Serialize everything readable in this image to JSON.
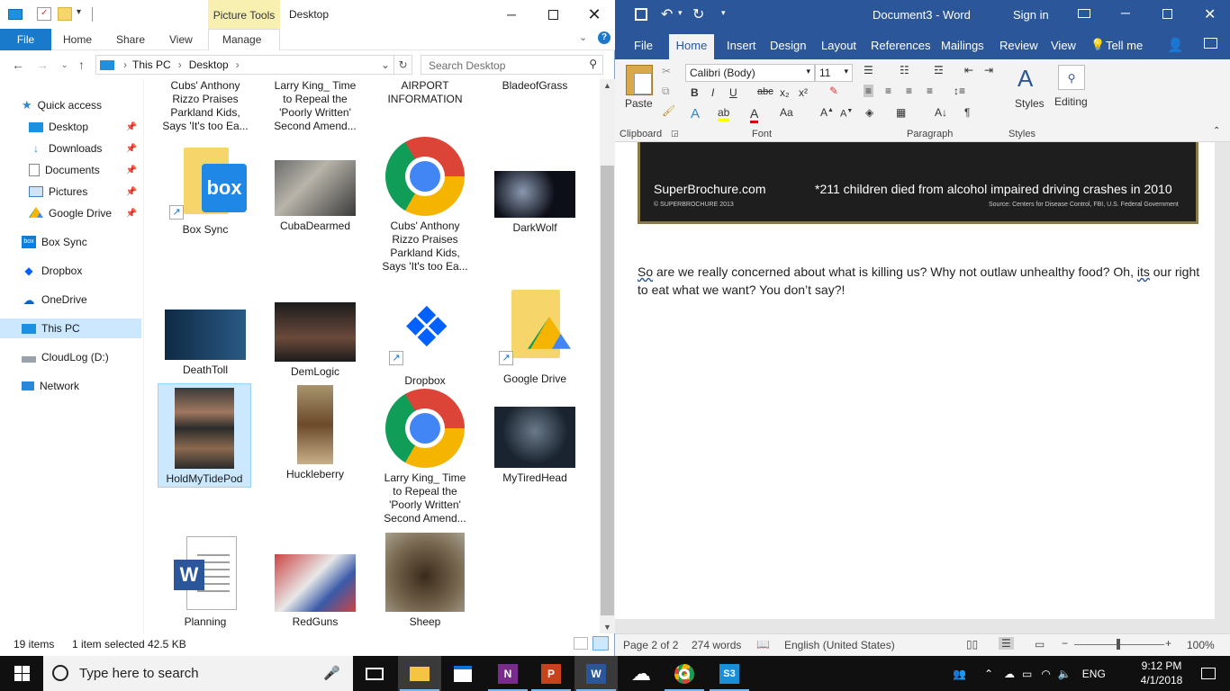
{
  "explorer": {
    "context_tab": "Picture Tools",
    "title": "Desktop",
    "ribbon_tabs": [
      "File",
      "Home",
      "Share",
      "View",
      "Manage"
    ],
    "address": [
      "This PC",
      "Desktop"
    ],
    "search_placeholder": "Search Desktop",
    "nav": {
      "quick_access": "Quick access",
      "pinned": [
        "Desktop",
        "Downloads",
        "Documents",
        "Pictures",
        "Google Drive"
      ],
      "others": [
        "Box Sync",
        "Dropbox",
        "OneDrive",
        "This PC",
        "CloudLog (D:)",
        "Network"
      ]
    },
    "files_top_partial": [
      "Cubs' Anthony Rizzo Praises Parkland Kids, Says 'It's too Ea...",
      "Larry King_ Time to Repeal the 'Poorly Written' Second Amend...",
      "AIRPORT INFORMATION",
      "BladeofGrass"
    ],
    "files": [
      "Box Sync",
      "CubaDearmed",
      "Cubs' Anthony Rizzo Praises Parkland Kids, Says 'It's too Ea...",
      "DarkWolf",
      "DeathToll",
      "DemLogic",
      "Dropbox",
      "Google Drive",
      "HoldMyTidePod",
      "Huckleberry",
      "Larry King_ Time to Repeal the 'Poorly Written' Second Amend...",
      "MyTiredHead",
      "Planning",
      "RedGuns",
      "Sheep"
    ],
    "status": {
      "count": "19 items",
      "selected": "1 item selected",
      "size": "42.5 KB"
    }
  },
  "word": {
    "title": "Document3  -  Word",
    "sign_in": "Sign in",
    "tabs": [
      "File",
      "Home",
      "Insert",
      "Design",
      "Layout",
      "References",
      "Mailings",
      "Review",
      "View"
    ],
    "tell_me": "Tell me",
    "font_name": "Calibri (Body)",
    "font_size": "11",
    "groups": [
      "Clipboard",
      "Font",
      "Paragraph",
      "Styles"
    ],
    "paste": "Paste",
    "styles": "Styles",
    "editing": "Editing",
    "banner_site": "SuperBrochure.com",
    "banner_copy": "© SUPERBROCHURE 2013",
    "banner_stat": "*211 children died from alcohol impaired driving crashes in 2010",
    "banner_source": "Source: Centers for Disease Control, FBI, U.S. Federal Government",
    "paragraph_w1": "So",
    "paragraph_mid": " are we really concerned about what is killing us? Why not outlaw unhealthy food? Oh, ",
    "paragraph_w2": "its",
    "paragraph_end": " our right to eat what we want? You don’t say?!",
    "status": {
      "page": "Page 2 of 2",
      "words": "274 words",
      "language": "English (United States)",
      "zoom": "100%"
    }
  },
  "taskbar": {
    "search_placeholder": "Type here to search",
    "language": "ENG",
    "time": "9:12 PM",
    "date": "4/1/2018"
  }
}
